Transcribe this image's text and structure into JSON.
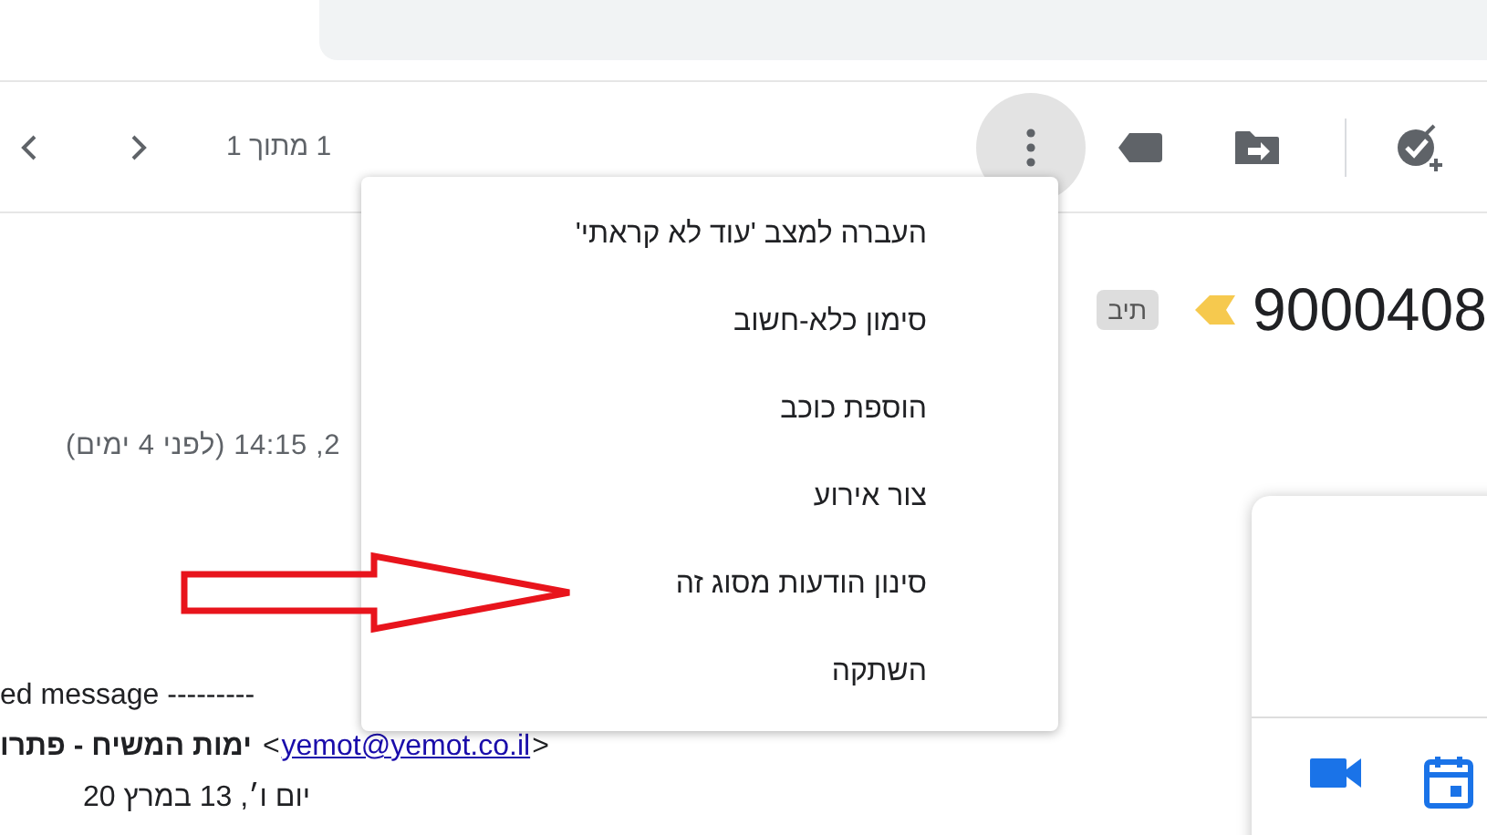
{
  "toolbar": {
    "page_count": "1 מתוך 1",
    "more_menu_open": true
  },
  "subject": {
    "title": "9000408",
    "label": "תיב"
  },
  "message": {
    "date": "2, 14:15 (לפני 4 ימים)",
    "forward_line": "ed message ---------",
    "sender_name": "ימות המשיח - פתרו",
    "sender_open": "<",
    "sender_email": "yemot@yemot.co.il",
    "sender_close": ">",
    "date_line": "יום ו׳, 13 במרץ 20"
  },
  "menu": {
    "items": [
      {
        "label": "העברה למצב 'עוד לא קראתי'"
      },
      {
        "label": "סימון כלא-חשוב"
      },
      {
        "label": "הוספת כוכב"
      },
      {
        "label": "צור אירוע"
      },
      {
        "label": "סינון הודעות מסוג זה"
      },
      {
        "label": "השתקה"
      }
    ]
  }
}
